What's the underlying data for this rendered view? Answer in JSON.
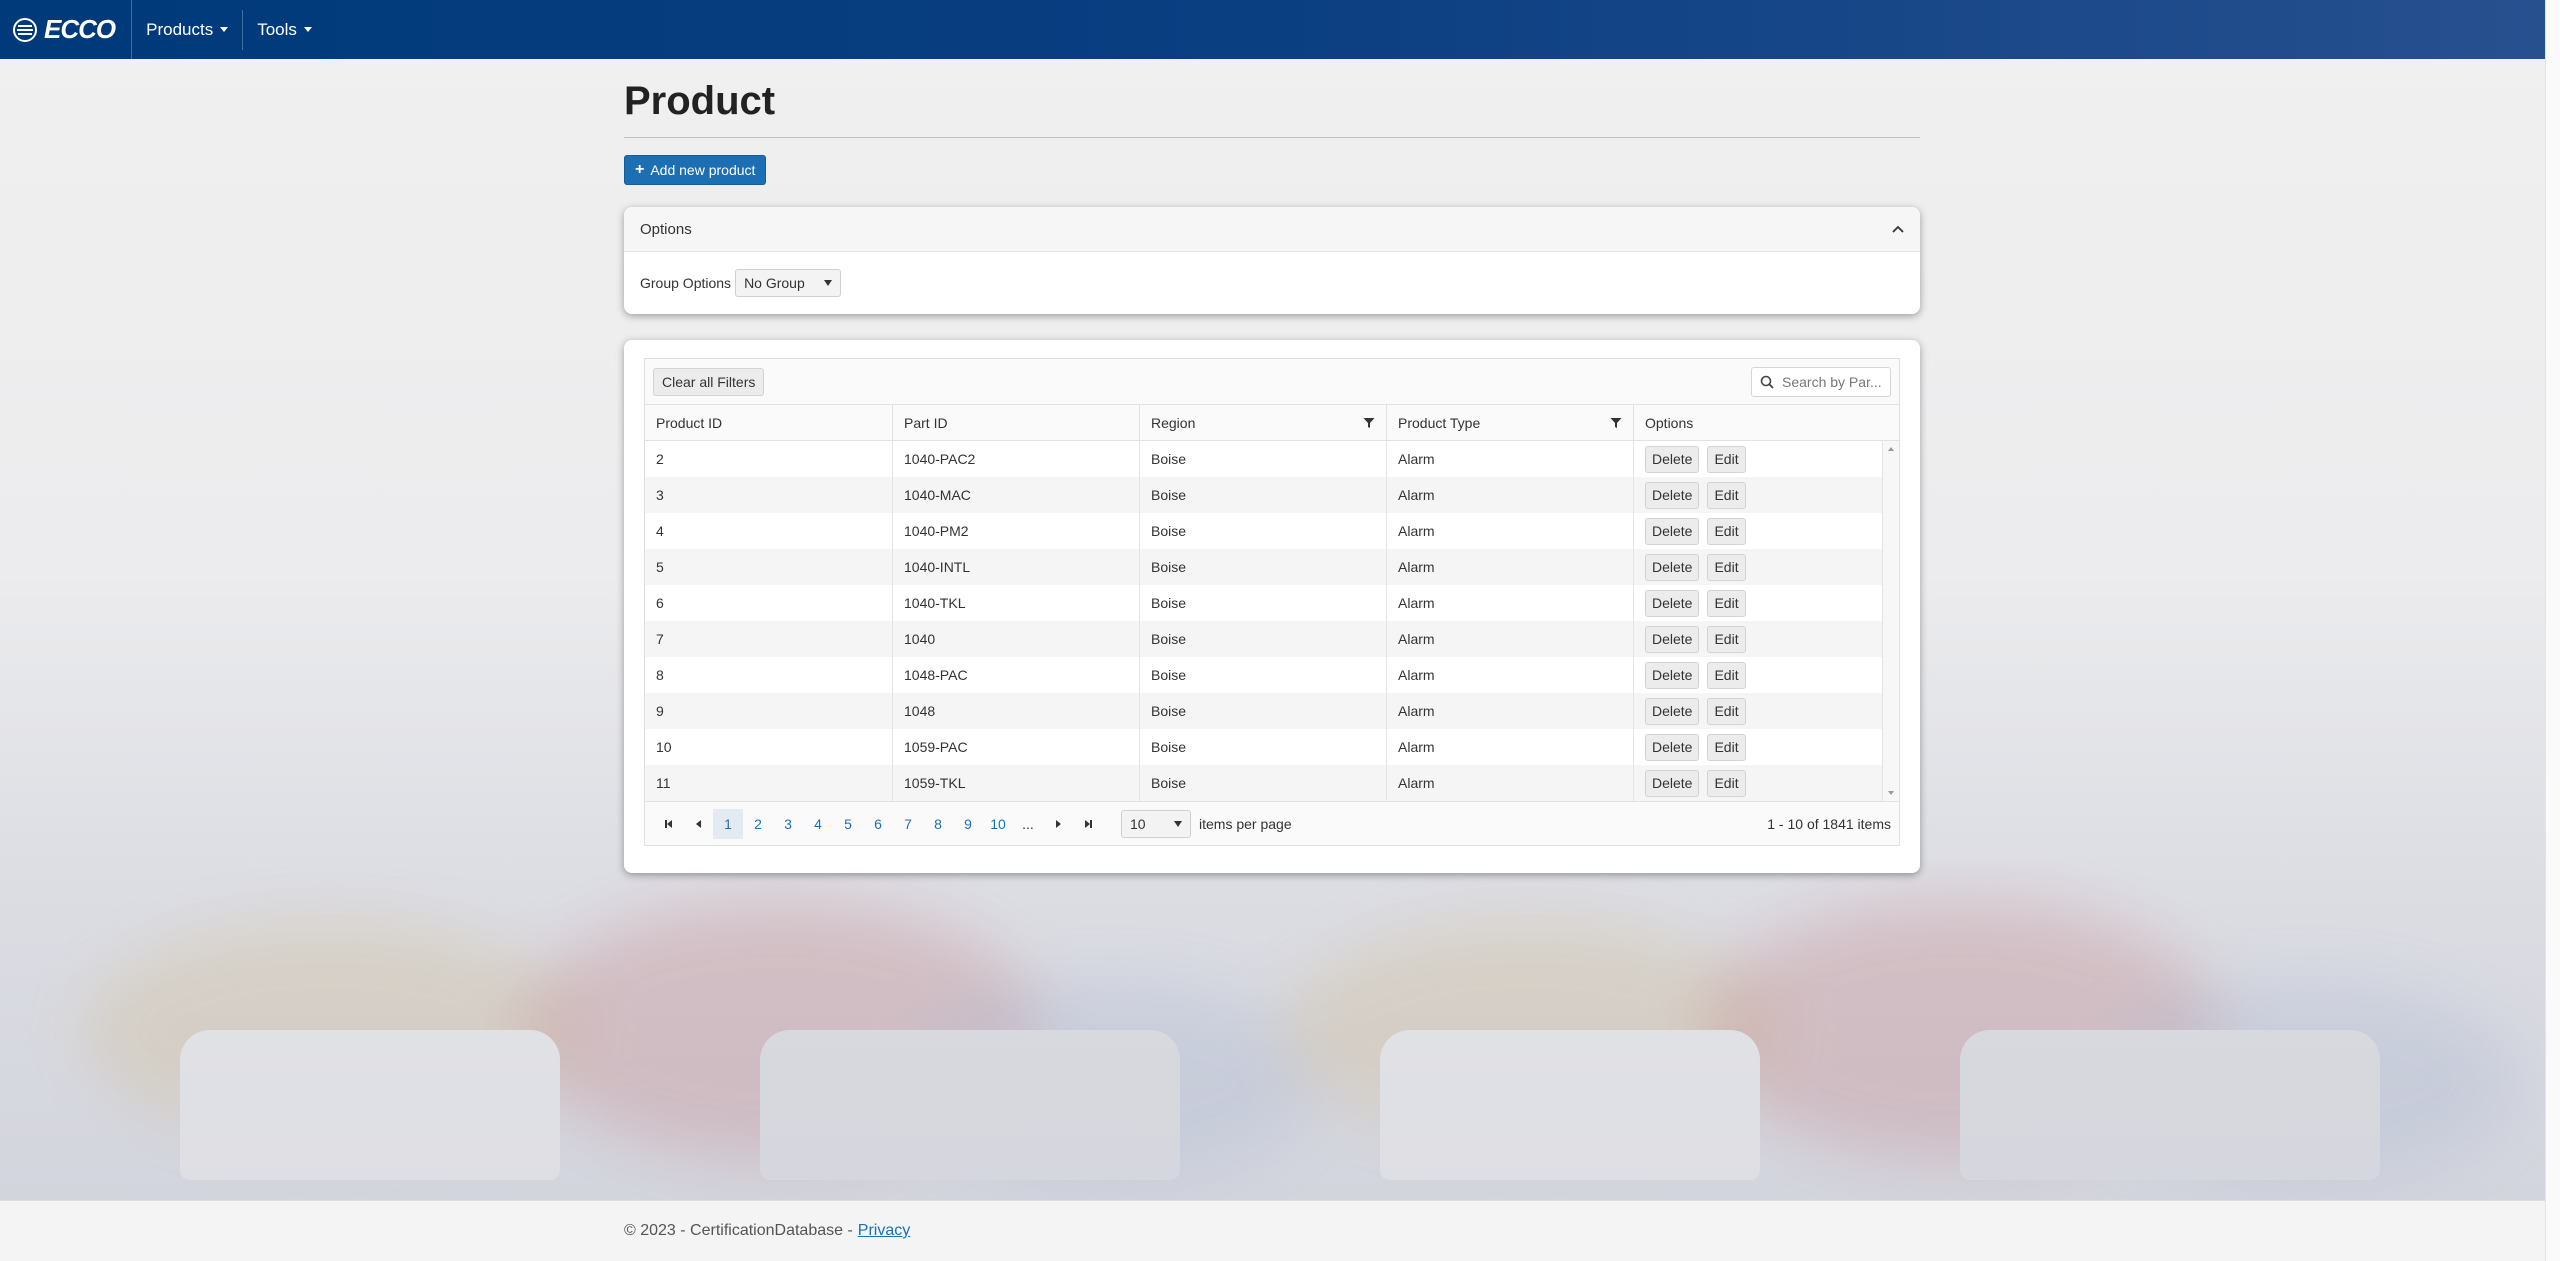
{
  "navbar": {
    "brand": "ECCO",
    "menu": [
      {
        "label": "Products"
      },
      {
        "label": "Tools"
      }
    ]
  },
  "page": {
    "title": "Product",
    "add_button_label": "Add new product"
  },
  "options_panel": {
    "title": "Options",
    "group_label": "Group Options",
    "group_value": "No Group"
  },
  "grid": {
    "clear_filters_label": "Clear all Filters",
    "search_placeholder": "Search by Par...",
    "columns": [
      "Product ID",
      "Part ID",
      "Region",
      "Product Type",
      "Options"
    ],
    "delete_label": "Delete",
    "edit_label": "Edit",
    "rows": [
      {
        "product_id": "2",
        "part_id": "1040-PAC2",
        "region": "Boise",
        "product_type": "Alarm"
      },
      {
        "product_id": "3",
        "part_id": "1040-MAC",
        "region": "Boise",
        "product_type": "Alarm"
      },
      {
        "product_id": "4",
        "part_id": "1040-PM2",
        "region": "Boise",
        "product_type": "Alarm"
      },
      {
        "product_id": "5",
        "part_id": "1040-INTL",
        "region": "Boise",
        "product_type": "Alarm"
      },
      {
        "product_id": "6",
        "part_id": "1040-TKL",
        "region": "Boise",
        "product_type": "Alarm"
      },
      {
        "product_id": "7",
        "part_id": "1040",
        "region": "Boise",
        "product_type": "Alarm"
      },
      {
        "product_id": "8",
        "part_id": "1048-PAC",
        "region": "Boise",
        "product_type": "Alarm"
      },
      {
        "product_id": "9",
        "part_id": "1048",
        "region": "Boise",
        "product_type": "Alarm"
      },
      {
        "product_id": "10",
        "part_id": "1059-PAC",
        "region": "Boise",
        "product_type": "Alarm"
      },
      {
        "product_id": "11",
        "part_id": "1059-TKL",
        "region": "Boise",
        "product_type": "Alarm"
      }
    ]
  },
  "pager": {
    "pages": [
      "1",
      "2",
      "3",
      "4",
      "5",
      "6",
      "7",
      "8",
      "9",
      "10",
      "..."
    ],
    "current_page": "1",
    "page_size": "10",
    "items_per_page_label": "items per page",
    "summary": "1 - 10 of 1841 items"
  },
  "footer": {
    "copyright": "© 2023 - CertificationDatabase -",
    "privacy_link": "Privacy"
  },
  "colors": {
    "navbar": "#003a7a",
    "primary_button": "#1d6fb3",
    "link": "#1d6fb3"
  }
}
